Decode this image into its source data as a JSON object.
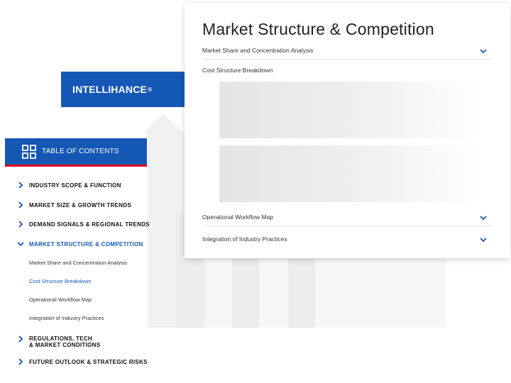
{
  "brand": {
    "name": "INTELLIHANCE",
    "reg_mark": "®"
  },
  "toc": {
    "header_label": "TABLE OF CONTENTS",
    "items": [
      {
        "label": "INDUSTRY SCOPE & FUNCTION",
        "expanded": false
      },
      {
        "label": "MARKET SIZE & GROWTH TRENDS",
        "expanded": false
      },
      {
        "label": "DEMAND SIGNALS & REGIONAL TRENDS",
        "expanded": false
      },
      {
        "label": "MARKET STRUCTURE & COMPETITION",
        "expanded": true
      },
      {
        "label_line1": "REGULATIONS, TECH",
        "label_line2": "& MARKET CONDITIONS",
        "expanded": false
      },
      {
        "label": "FUTURE OUTLOOK & STRATEGIC RISKS",
        "expanded": false
      }
    ],
    "sub_items": [
      "Market Share and Concentration Analysis",
      "Cost Structure Breakdown",
      "Operational Workflow Map",
      "Integration of Industry Practices"
    ],
    "current_sub_item": "Cost Structure Breakdown"
  },
  "card": {
    "title": "Market Structure & Competition",
    "sections": [
      {
        "label": "Market Share and Concentration Analysis",
        "state": "collapsed"
      },
      {
        "label": "Cost Structure Breakdown",
        "state": "expanded"
      },
      {
        "label": "Operational Workflow Map",
        "state": "collapsed"
      },
      {
        "label": "Integration of Industry Practices",
        "state": "collapsed"
      }
    ]
  },
  "colors": {
    "brand_blue": "#1557b5",
    "accent_red": "#e2001a",
    "text_dark": "#111111",
    "divider": "#e2e2e2"
  },
  "icons": [
    "grid-icon",
    "chevron-right-icon",
    "chevron-down-icon"
  ]
}
